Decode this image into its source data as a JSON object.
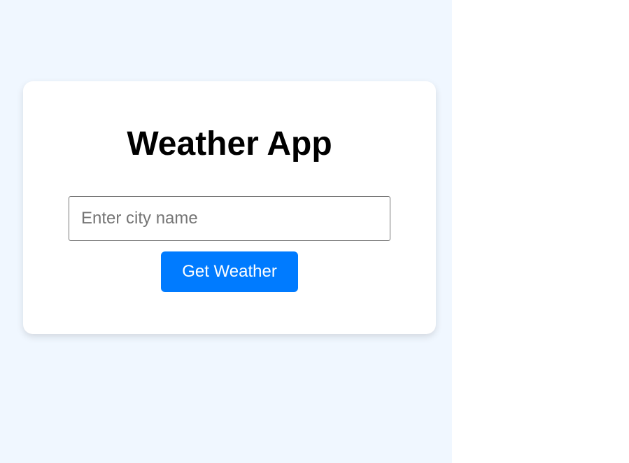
{
  "app": {
    "title": "Weather App"
  },
  "search": {
    "placeholder": "Enter city name",
    "value": ""
  },
  "actions": {
    "get_weather_label": "Get Weather"
  },
  "colors": {
    "page_background": "#f0f7ff",
    "card_background": "#ffffff",
    "button_background": "#007bff",
    "button_text": "#ffffff"
  }
}
